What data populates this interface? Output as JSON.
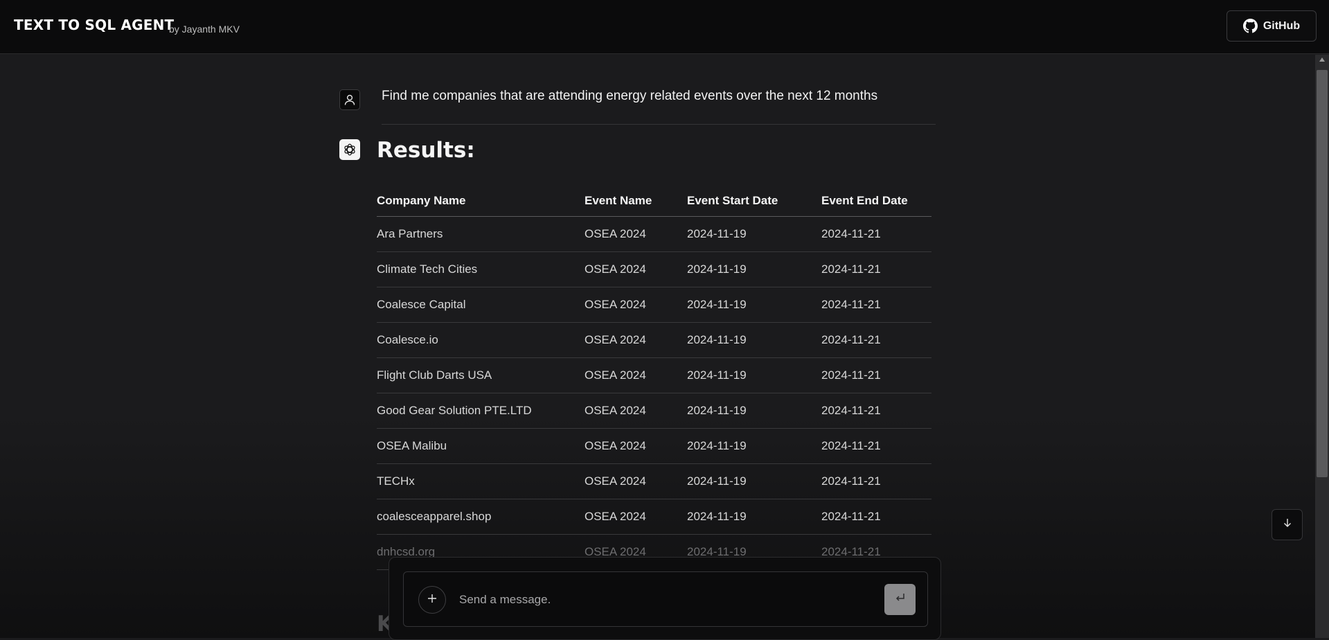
{
  "header": {
    "title": "TEXT TO SQL AGENT",
    "byline": "by Jayanth MKV",
    "github_label": "GitHub"
  },
  "chat": {
    "user_message": "Find me companies that are attending energy related events over the next 12 months",
    "results_title": "Results:",
    "table": {
      "columns": [
        "Company Name",
        "Event Name",
        "Event Start Date",
        "Event End Date"
      ],
      "rows": [
        [
          "Ara Partners",
          "OSEA 2024",
          "2024-11-19",
          "2024-11-21"
        ],
        [
          "Climate Tech Cities",
          "OSEA 2024",
          "2024-11-19",
          "2024-11-21"
        ],
        [
          "Coalesce Capital",
          "OSEA 2024",
          "2024-11-19",
          "2024-11-21"
        ],
        [
          "Coalesce.io",
          "OSEA 2024",
          "2024-11-19",
          "2024-11-21"
        ],
        [
          "Flight Club Darts USA",
          "OSEA 2024",
          "2024-11-19",
          "2024-11-21"
        ],
        [
          "Good Gear Solution PTE.LTD",
          "OSEA 2024",
          "2024-11-19",
          "2024-11-21"
        ],
        [
          "OSEA Malibu",
          "OSEA 2024",
          "2024-11-19",
          "2024-11-21"
        ],
        [
          "TECHx",
          "OSEA 2024",
          "2024-11-19",
          "2024-11-21"
        ],
        [
          "coalesceapparel.shop",
          "OSEA 2024",
          "2024-11-19",
          "2024-11-21"
        ],
        [
          "dnhcsd.org",
          "OSEA 2024",
          "2024-11-19",
          "2024-11-21"
        ]
      ]
    },
    "partial_next_heading": "K"
  },
  "composer": {
    "placeholder": "Send a message.",
    "value": "",
    "send_icon": "enter-icon",
    "add_icon": "plus-icon"
  },
  "icons": {
    "github": "github-icon",
    "user_avatar": "user-icon",
    "assistant_avatar": "openai-icon",
    "scroll_down": "arrow-down-icon"
  }
}
